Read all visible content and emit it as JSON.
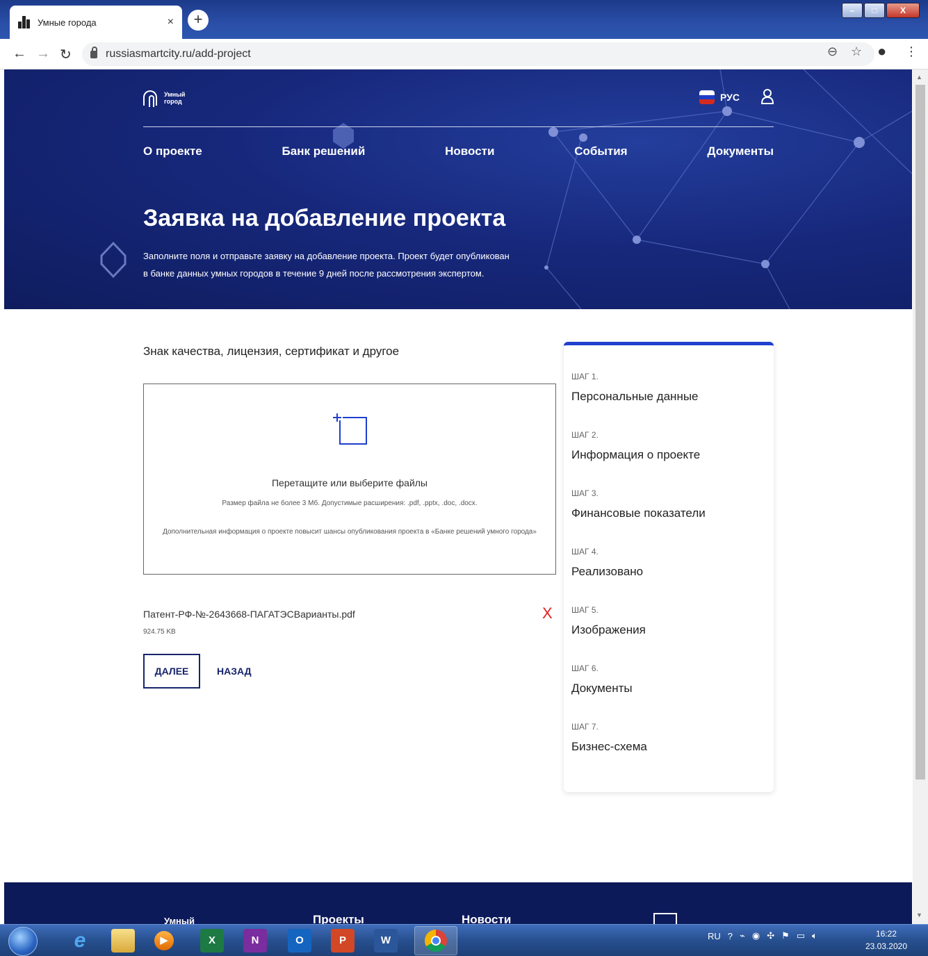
{
  "browser": {
    "tab_title": "Умные города",
    "tab_close": "×",
    "new_tab": "+",
    "url": "russiasmartcity.ru/add-project",
    "window_buttons": {
      "minimize": "–",
      "maximize": "□",
      "close": "X"
    }
  },
  "site": {
    "logo_text": "Умный город",
    "language": "РУС",
    "menu": [
      "О проекте",
      "Банк решений",
      "Новости",
      "События",
      "Документы"
    ],
    "hero_title": "Заявка на добавление проекта",
    "hero_subtitle_line1": "Заполните поля и отправьте заявку на добавление проекта. Проект будет опубликован",
    "hero_subtitle_line2": "в банке данных умных городов в течение 9 дней после рассмотрения экспертом."
  },
  "form": {
    "section_title": "Знак качества, лицензия, сертификат и другое",
    "dropzone": {
      "icon": "add-file-icon",
      "title": "Перетащите или выберите файлы",
      "note1": "Размер файла не более 3 Мб. Допустимые расширения: .pdf, .pptx, .doc, .docx.",
      "note2": "Дополнительная информация о проекте повысит шансы опубликования проекта в «Банке решений умного города»"
    },
    "file": {
      "name": "Патент-РФ-№-2643668-ПАГАТЭСВарианты.pdf",
      "size": "924.75 KB",
      "remove": "X"
    },
    "next_label": "ДАЛЕЕ",
    "back_label": "НАЗАД"
  },
  "steps": [
    {
      "num": "ШАГ 1.",
      "name": "Персональные данные"
    },
    {
      "num": "ШАГ 2.",
      "name": "Информация о проекте"
    },
    {
      "num": "ШАГ 3.",
      "name": "Финансовые показатели"
    },
    {
      "num": "ШАГ 4.",
      "name": "Реализовано"
    },
    {
      "num": "ШАГ 5.",
      "name": "Изображения"
    },
    {
      "num": "ШАГ 6.",
      "name": "Документы"
    },
    {
      "num": "ШАГ 7.",
      "name": "Бизнес-схема"
    }
  ],
  "footer": {
    "items": [
      "Умный",
      "Проекты",
      "Новости"
    ]
  },
  "taskbar": {
    "apps": [
      "ie",
      "explorer",
      "media",
      "X",
      "N",
      "O",
      "P",
      "W",
      "chrome"
    ],
    "lang": "RU",
    "time": "16:22",
    "date": "23.03.2020"
  },
  "colors": {
    "accent": "#1f3fcf",
    "brand_dark": "#17246c",
    "danger": "#e02020"
  }
}
